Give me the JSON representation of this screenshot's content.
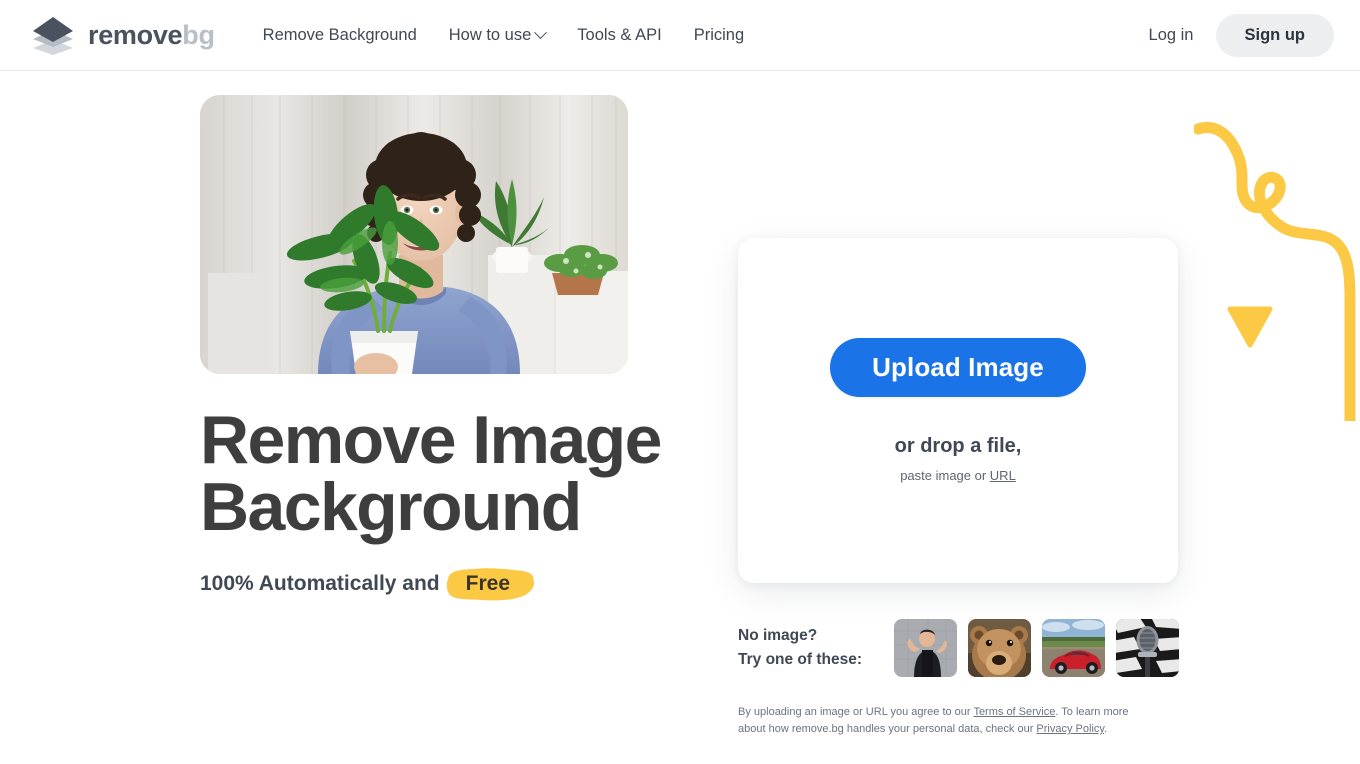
{
  "brand": {
    "logo_icon": "layers-diamond-icon",
    "name_primary": "remove",
    "name_secondary": "bg"
  },
  "header": {
    "nav": [
      {
        "label": "Remove Background",
        "icon": null
      },
      {
        "label": "How to use",
        "icon": "chevron-down-icon"
      },
      {
        "label": "Tools & API",
        "icon": null
      },
      {
        "label": "Pricing",
        "icon": null
      }
    ],
    "login_label": "Log in",
    "signup_label": "Sign up"
  },
  "hero": {
    "photo_alt": "man-with-plant-photo",
    "headline": "Remove Image Background",
    "subline_prefix": "100% Automatically and",
    "subline_highlight": "Free"
  },
  "upload": {
    "button_label": "Upload Image",
    "drop_label": "or drop a file,",
    "paste_prefix": "paste image or ",
    "paste_link": "URL"
  },
  "samples": {
    "label_line1": "No image?",
    "label_line2": "Try one of these:",
    "thumbs": [
      {
        "name": "sample-woman-flexing"
      },
      {
        "name": "sample-bear"
      },
      {
        "name": "sample-red-car"
      },
      {
        "name": "sample-microphone"
      }
    ]
  },
  "legal": {
    "part1": "By uploading an image or URL you agree to our ",
    "link1": "Terms of Service",
    "part2": ". To learn more about how remove.bg handles your personal data, check our ",
    "link2": "Privacy Policy",
    "part3": "."
  },
  "decor": {
    "squiggle": "yellow-squiggle-line",
    "triangle": "yellow-triangle"
  },
  "colors": {
    "accent_blue": "#1a74e8",
    "accent_yellow": "#fbc944",
    "text_dark": "#3f4854",
    "heading": "#3e3e3e",
    "brand_gray": "#b9bfc8",
    "chip_gray": "#eceef0"
  }
}
